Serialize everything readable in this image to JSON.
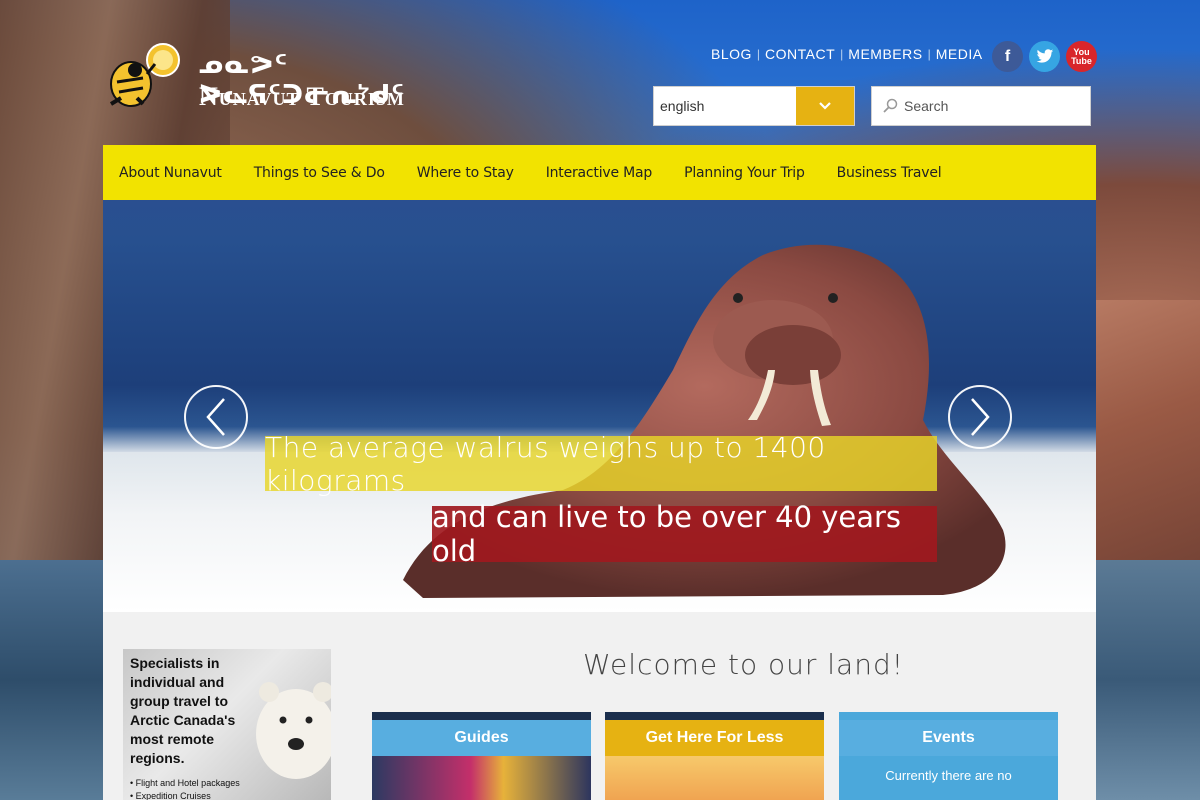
{
  "brand": {
    "syllabics": "ᓄᓇᕗᑦ ᐳᓚᕋᑦᑐᓕᕆᔾᑯᑦ",
    "name": "Nunavut Tourism"
  },
  "topnav": {
    "items": [
      "BLOG",
      "CONTACT",
      "MEMBERS",
      "MEDIA"
    ]
  },
  "social": {
    "facebook": "f",
    "twitter": "t",
    "youtube": "You Tube"
  },
  "language": {
    "value": "english"
  },
  "search": {
    "placeholder": "Search"
  },
  "mainnav": {
    "items": [
      "About Nunavut",
      "Things to See & Do",
      "Where to Stay",
      "Interactive Map",
      "Planning Your Trip",
      "Business Travel"
    ]
  },
  "hero": {
    "caption_line1": "The average walrus weighs up to 1400 kilograms",
    "caption_line2": "and can live to be over 40 years old"
  },
  "promo": {
    "headline": "Specialists in individual and group travel to Arctic Canada's most remote regions.",
    "bullets": [
      "• Flight and Hotel packages",
      "• Expedition Cruises"
    ]
  },
  "welcome": {
    "title": "Welcome to our land!"
  },
  "cards": {
    "guides": "Guides",
    "fly": "Get Here For Less",
    "events": "Events",
    "events_body": "Currently there are no"
  },
  "colors": {
    "nav_yellow": "#f2e300",
    "accent_gold": "#e6b212",
    "accent_blue": "#58aee0",
    "caption_red": "#a0191e"
  }
}
